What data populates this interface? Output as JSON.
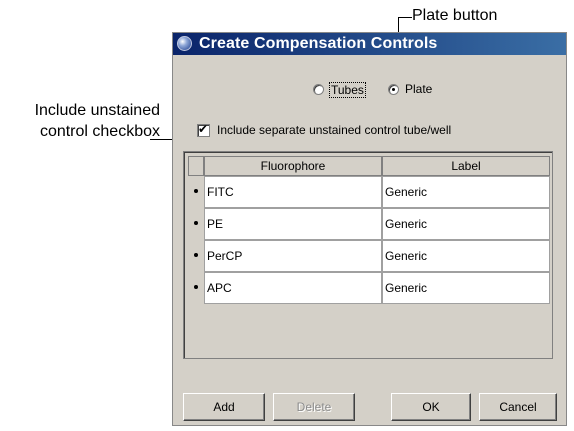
{
  "callouts": {
    "plate_button": "Plate button",
    "unstained_checkbox": "Include unstained control checkbox"
  },
  "dialog": {
    "title": "Create Compensation Controls",
    "radios": {
      "tubes_label": "Tubes",
      "tubes_checked": false,
      "plate_label": "Plate",
      "plate_checked": true
    },
    "checkbox": {
      "label": "Include separate unstained control tube/well",
      "checked": true
    },
    "table": {
      "headers": [
        "Fluorophore",
        "Label"
      ],
      "rows": [
        {
          "fluorophore": "FITC",
          "label": "Generic"
        },
        {
          "fluorophore": "PE",
          "label": "Generic"
        },
        {
          "fluorophore": "PerCP",
          "label": "Generic"
        },
        {
          "fluorophore": "APC",
          "label": "Generic"
        }
      ]
    },
    "buttons": {
      "add": "Add",
      "delete": "Delete",
      "delete_enabled": false,
      "ok": "OK",
      "cancel": "Cancel"
    }
  },
  "colors": {
    "dialog_background": "#d4d0c8",
    "title_bar": "#0a246a",
    "disabled_text": "#8c8c8c"
  }
}
